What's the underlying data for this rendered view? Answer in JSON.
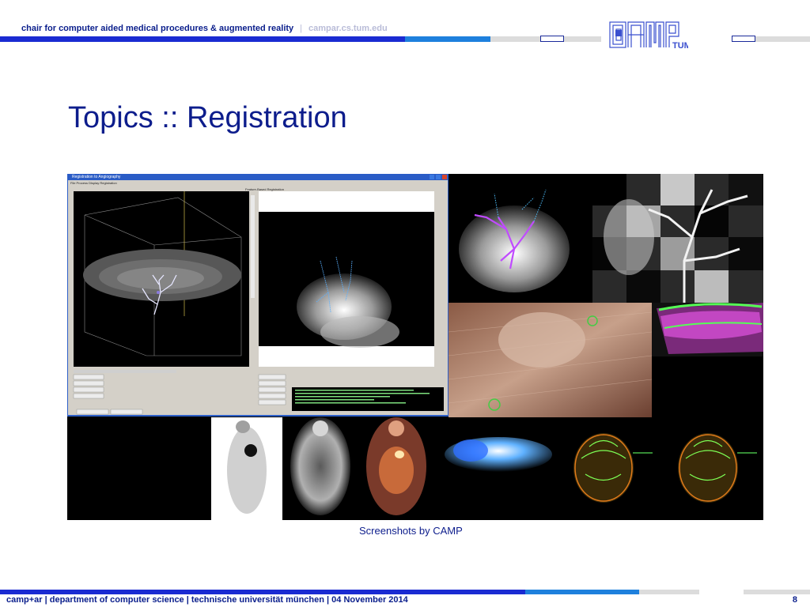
{
  "header": {
    "chair": "chair for computer aided medical procedures & augmented reality",
    "separator": "|",
    "url": "campar.cs.tum.edu",
    "logo_text": "CAMP",
    "logo_sub": "TUM"
  },
  "slide": {
    "title": "Topics :: Registration",
    "caption": "Screenshots by CAMP"
  },
  "app_window": {
    "title": "Registration to Angiography",
    "menu": "File   Process   Display   Registration",
    "panel_label": "Feature-Based Registration"
  },
  "footer": {
    "text": "camp+ar  |  department of computer science  |  technische universität münchen  | 04 November 2014",
    "page": "8"
  },
  "colors": {
    "navy": "#0a1e8c",
    "blue": "#2233cc",
    "light_blue": "#1e7ad6",
    "light_gray": "#d9d9d9"
  }
}
